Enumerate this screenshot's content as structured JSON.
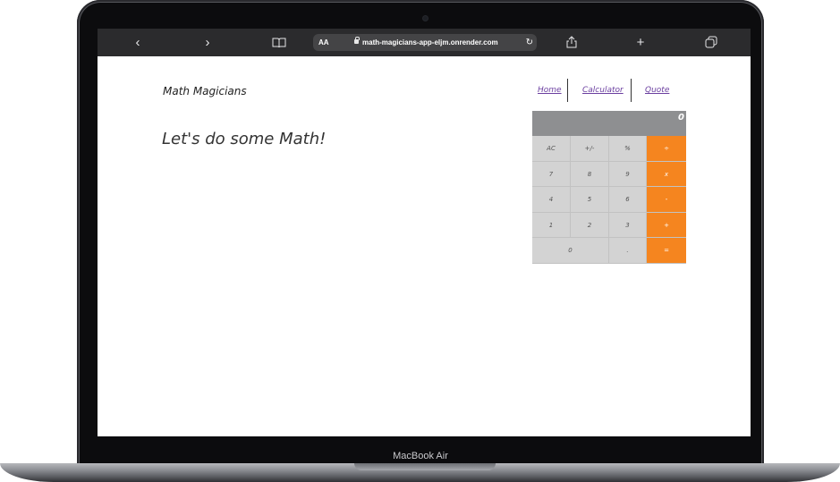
{
  "browser": {
    "back_icon": "‹",
    "forward_icon": "›",
    "bookmarks_icon": "book-icon",
    "text_size_label": "AA",
    "url": "math-magicians-app-eljm.onrender.com",
    "reload_icon": "↻",
    "share_icon": "share-icon",
    "new_tab_icon": "+",
    "tabs_icon": "tabs-icon"
  },
  "page": {
    "brand": "Math Magicians",
    "headline": "Let's do some Math!",
    "nav": [
      {
        "label": "Home"
      },
      {
        "label": "Calculator"
      },
      {
        "label": "Quote"
      }
    ]
  },
  "calculator": {
    "display": "0",
    "rows": [
      [
        "AC",
        "+/-",
        "%",
        "÷"
      ],
      [
        "7",
        "8",
        "9",
        "x"
      ],
      [
        "4",
        "5",
        "6",
        "-"
      ],
      [
        "1",
        "2",
        "3",
        "+"
      ],
      [
        "0",
        ".",
        "="
      ]
    ],
    "operator_color": "#f5851f",
    "key_color": "#d3d3d3",
    "display_color": "#8e8f91"
  },
  "device": {
    "label": "MacBook Air"
  }
}
